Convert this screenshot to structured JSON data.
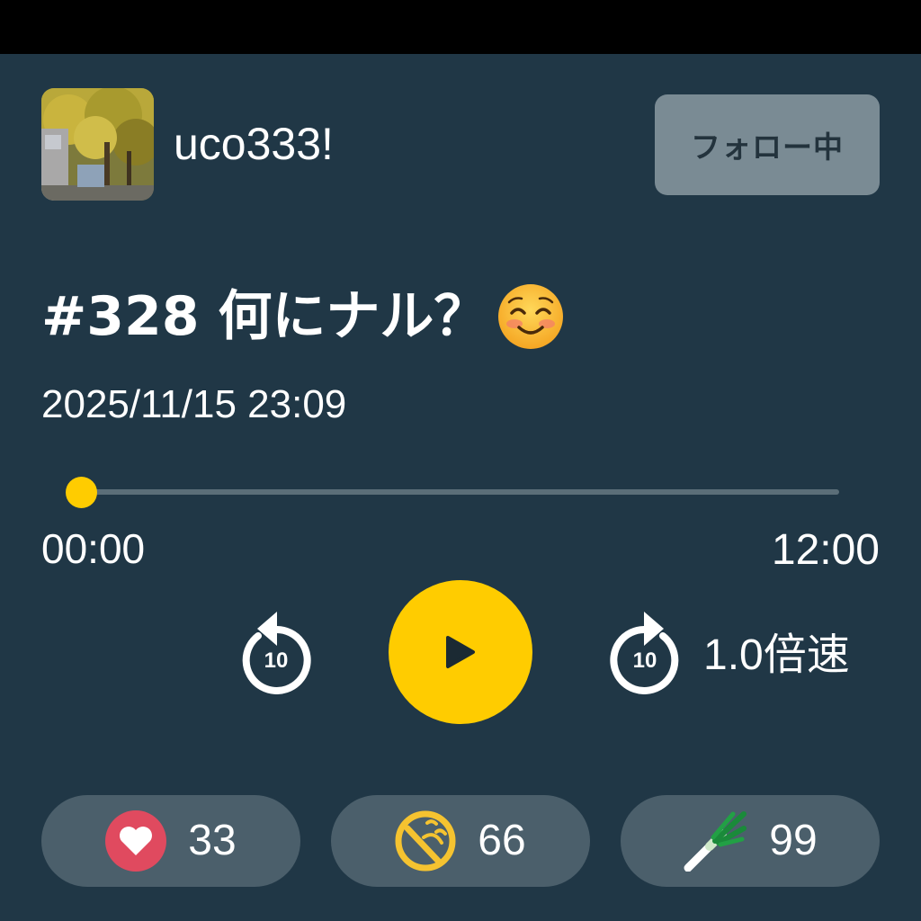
{
  "profile": {
    "username": "uco333!",
    "follow_label": "フォロー中"
  },
  "episode": {
    "title": "#328 何にナル？",
    "title_emoji": "smiling-face-emoji",
    "date": "2025/11/15 23:09"
  },
  "player": {
    "current_time": "00:00",
    "total_time": "12:00",
    "progress_fraction": 0,
    "skip_back_seconds": "10",
    "skip_forward_seconds": "10",
    "speed_label": "1.0倍速",
    "accent_color": "#ffcc00"
  },
  "reactions": [
    {
      "icon": "heart-icon",
      "count": "33",
      "color": "#e04a5f"
    },
    {
      "icon": "laughing-face-icon",
      "count": "66",
      "color": "#f5c330"
    },
    {
      "icon": "green-onion-icon",
      "count": "99",
      "color": "#1a8a3a"
    }
  ]
}
